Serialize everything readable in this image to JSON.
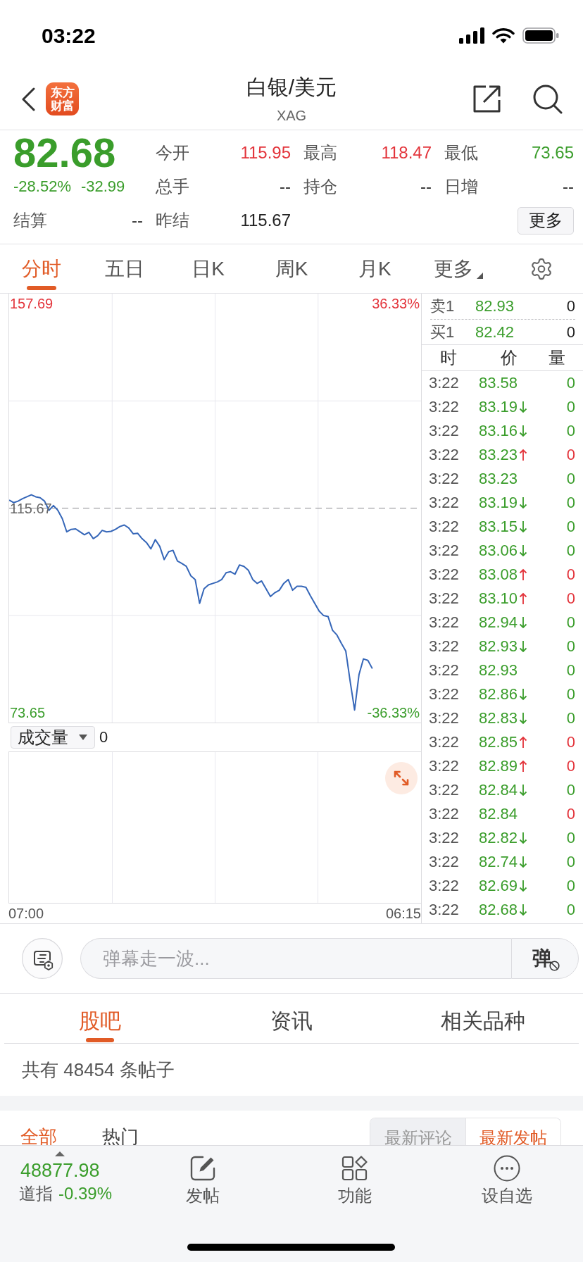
{
  "status_bar": {
    "time": "03:22"
  },
  "header": {
    "logo": "东方财富",
    "title": "白银/美元",
    "subtitle": "XAG"
  },
  "quote": {
    "price": {
      "text": "82.68",
      "color": "#3a9d2b"
    },
    "change_percent": {
      "text": "-28.52%",
      "color": "#3a9d2b"
    },
    "change": {
      "text": "-32.99",
      "color": "#3a9d2b"
    },
    "stats": [
      {
        "name": "今开",
        "value": "115.95",
        "color": "#e3343b"
      },
      {
        "name": "最高",
        "value": "118.47",
        "color": "#e3343b"
      },
      {
        "name": "最低",
        "value": "73.65",
        "color": "#3a9d2b"
      },
      {
        "name": "总手",
        "value": "--",
        "color": "#333333"
      },
      {
        "name": "持仓",
        "value": "--",
        "color": "#333333"
      },
      {
        "name": "日增",
        "value": "--",
        "color": "#333333"
      },
      {
        "name": "结算",
        "value": "--",
        "color": "#333333"
      },
      {
        "name": "昨结",
        "value": "115.67",
        "color": "#222222"
      }
    ],
    "more_button": "更多"
  },
  "chart_tabs": [
    {
      "label": "分时",
      "selected": true,
      "dropdown": false
    },
    {
      "label": "五日",
      "selected": false,
      "dropdown": false
    },
    {
      "label": "日K",
      "selected": false,
      "dropdown": false
    },
    {
      "label": "周K",
      "selected": false,
      "dropdown": false
    },
    {
      "label": "月K",
      "selected": false,
      "dropdown": false
    },
    {
      "label": "更多",
      "selected": false,
      "dropdown": true
    }
  ],
  "price_chart": {
    "percent_labels": [
      {
        "text": "36.33%",
        "color": "#e3343b"
      },
      {
        "text": "-36.33%",
        "color": "#3a9d2b"
      }
    ],
    "chart_data": {
      "type": "line",
      "categories": [
        null,
        null,
        null,
        null,
        null,
        null,
        null,
        null,
        null,
        null,
        null,
        null,
        null,
        null,
        null,
        null,
        null,
        null,
        null,
        null,
        null,
        null,
        null,
        null,
        null,
        null,
        null,
        null,
        null,
        null,
        null,
        null,
        null,
        null,
        null,
        null,
        null,
        null,
        null,
        null,
        null,
        null,
        null,
        null,
        null,
        null,
        null,
        null,
        null,
        null,
        null,
        null,
        null,
        null,
        null,
        null,
        null,
        null,
        null,
        null,
        null,
        null,
        null,
        null,
        null,
        null,
        null,
        null,
        null,
        null,
        null,
        null,
        null,
        null,
        null,
        null,
        null,
        null,
        null,
        null,
        null,
        null,
        null,
        null,
        null,
        null,
        null,
        null,
        null,
        null,
        null,
        null,
        null,
        null
      ],
      "series": [
        {
          "color": "#3566b8",
          "values": [
            117.3,
            116.8,
            117.1,
            117.6,
            118.0,
            118.4,
            118.0,
            117.8,
            117.1,
            115.2,
            116.2,
            115.2,
            113.5,
            110.8,
            111.3,
            111.4,
            110.8,
            110.2,
            110.7,
            109.4,
            110.0,
            111.1,
            110.8,
            110.9,
            111.3,
            111.9,
            112.2,
            111.6,
            110.4,
            110.5,
            109.4,
            108.6,
            107.3,
            109.2,
            107.8,
            105.1,
            106.7,
            107.0,
            104.8,
            104.3,
            103.7,
            101.8,
            101.0,
            96.1,
            99.1,
            99.9,
            100.2,
            100.5,
            101.0,
            102.4,
            102.6,
            102.1,
            104.0,
            103.7,
            102.9,
            101.0,
            100.2,
            100.7,
            99.1,
            97.5,
            98.3,
            98.8,
            100.2,
            101.0,
            98.8,
            99.6,
            99.6,
            99.4,
            97.7,
            96.1,
            94.5,
            93.6,
            93.4,
            90.6,
            89.6,
            87.9,
            86.3,
            80.0,
            74.2,
            81.5,
            84.7,
            84.4,
            82.7,
            null,
            null,
            null,
            null,
            null,
            null,
            null,
            null,
            null,
            null,
            null
          ]
        }
      ],
      "ylim": [
        71.62,
        159.72
      ],
      "yticks": [
        {
          "value": 157.69,
          "label": "157.69"
        },
        {
          "value": 115.67,
          "label": "115.67"
        },
        {
          "value": 73.65,
          "label": "73.65"
        }
      ],
      "ref_lines": [
        {
          "axis": "y",
          "value": 115.67
        }
      ]
    }
  },
  "volume": {
    "indicator": "成交量",
    "value": "0"
  },
  "time_axis": [
    "07:00",
    "06:15"
  ],
  "order_book": [
    {
      "side": "卖1",
      "price": {
        "text": "82.93",
        "color": "#3a9d2b"
      },
      "volume": "0"
    },
    {
      "side": "买1",
      "price": {
        "text": "82.42",
        "color": "#3a9d2b"
      },
      "volume": "0"
    }
  ],
  "trades": {
    "columns": [
      "时",
      "价",
      "量"
    ],
    "rows": [
      {
        "time": "3:22",
        "price": {
          "text": "83.58",
          "color": "#3a9d2b"
        },
        "kind": "flat",
        "volume": {
          "text": "0",
          "color": "#3a9d2b"
        }
      },
      {
        "time": "3:22",
        "price": {
          "text": "83.19",
          "color": "#3a9d2b"
        },
        "kind": "down",
        "volume": {
          "text": "0",
          "color": "#3a9d2b"
        }
      },
      {
        "time": "3:22",
        "price": {
          "text": "83.16",
          "color": "#3a9d2b"
        },
        "kind": "down",
        "volume": {
          "text": "0",
          "color": "#3a9d2b"
        }
      },
      {
        "time": "3:22",
        "price": {
          "text": "83.23",
          "color": "#3a9d2b"
        },
        "kind": "up",
        "volume": {
          "text": "0",
          "color": "#e3343b"
        }
      },
      {
        "time": "3:22",
        "price": {
          "text": "83.23",
          "color": "#3a9d2b"
        },
        "kind": "flat",
        "volume": {
          "text": "0",
          "color": "#3a9d2b"
        }
      },
      {
        "time": "3:22",
        "price": {
          "text": "83.19",
          "color": "#3a9d2b"
        },
        "kind": "down",
        "volume": {
          "text": "0",
          "color": "#3a9d2b"
        }
      },
      {
        "time": "3:22",
        "price": {
          "text": "83.15",
          "color": "#3a9d2b"
        },
        "kind": "down",
        "volume": {
          "text": "0",
          "color": "#3a9d2b"
        }
      },
      {
        "time": "3:22",
        "price": {
          "text": "83.06",
          "color": "#3a9d2b"
        },
        "kind": "down",
        "volume": {
          "text": "0",
          "color": "#3a9d2b"
        }
      },
      {
        "time": "3:22",
        "price": {
          "text": "83.08",
          "color": "#3a9d2b"
        },
        "kind": "up",
        "volume": {
          "text": "0",
          "color": "#e3343b"
        }
      },
      {
        "time": "3:22",
        "price": {
          "text": "83.10",
          "color": "#3a9d2b"
        },
        "kind": "up",
        "volume": {
          "text": "0",
          "color": "#e3343b"
        }
      },
      {
        "time": "3:22",
        "price": {
          "text": "82.94",
          "color": "#3a9d2b"
        },
        "kind": "down",
        "volume": {
          "text": "0",
          "color": "#3a9d2b"
        }
      },
      {
        "time": "3:22",
        "price": {
          "text": "82.93",
          "color": "#3a9d2b"
        },
        "kind": "down",
        "volume": {
          "text": "0",
          "color": "#3a9d2b"
        }
      },
      {
        "time": "3:22",
        "price": {
          "text": "82.93",
          "color": "#3a9d2b"
        },
        "kind": "flat",
        "volume": {
          "text": "0",
          "color": "#3a9d2b"
        }
      },
      {
        "time": "3:22",
        "price": {
          "text": "82.86",
          "color": "#3a9d2b"
        },
        "kind": "down",
        "volume": {
          "text": "0",
          "color": "#3a9d2b"
        }
      },
      {
        "time": "3:22",
        "price": {
          "text": "82.83",
          "color": "#3a9d2b"
        },
        "kind": "down",
        "volume": {
          "text": "0",
          "color": "#3a9d2b"
        }
      },
      {
        "time": "3:22",
        "price": {
          "text": "82.85",
          "color": "#3a9d2b"
        },
        "kind": "up",
        "volume": {
          "text": "0",
          "color": "#e3343b"
        }
      },
      {
        "time": "3:22",
        "price": {
          "text": "82.89",
          "color": "#3a9d2b"
        },
        "kind": "up",
        "volume": {
          "text": "0",
          "color": "#e3343b"
        }
      },
      {
        "time": "3:22",
        "price": {
          "text": "82.84",
          "color": "#3a9d2b"
        },
        "kind": "down",
        "volume": {
          "text": "0",
          "color": "#3a9d2b"
        }
      },
      {
        "time": "3:22",
        "price": {
          "text": "82.84",
          "color": "#3a9d2b"
        },
        "kind": "flat",
        "volume": {
          "text": "0",
          "color": "#e3343b"
        }
      },
      {
        "time": "3:22",
        "price": {
          "text": "82.82",
          "color": "#3a9d2b"
        },
        "kind": "down",
        "volume": {
          "text": "0",
          "color": "#3a9d2b"
        }
      },
      {
        "time": "3:22",
        "price": {
          "text": "82.74",
          "color": "#3a9d2b"
        },
        "kind": "down",
        "volume": {
          "text": "0",
          "color": "#3a9d2b"
        }
      },
      {
        "time": "3:22",
        "price": {
          "text": "82.69",
          "color": "#3a9d2b"
        },
        "kind": "down",
        "volume": {
          "text": "0",
          "color": "#3a9d2b"
        }
      },
      {
        "time": "3:22",
        "price": {
          "text": "82.68",
          "color": "#3a9d2b"
        },
        "kind": "down",
        "volume": {
          "text": "0",
          "color": "#3a9d2b"
        }
      }
    ]
  },
  "comment_bar": {
    "placeholder": "弹幕走一波...",
    "toggle": "弹"
  },
  "community_tabs": [
    {
      "label": "股吧",
      "selected": true
    },
    {
      "label": "资讯",
      "selected": false
    },
    {
      "label": "相关品种",
      "selected": false
    }
  ],
  "post_count": "共有 48454 条帖子",
  "post_filters": [
    {
      "label": "全部",
      "selected": true
    },
    {
      "label": "热门",
      "selected": false
    }
  ],
  "sort_options": [
    {
      "label": "最新评论",
      "selected": false
    },
    {
      "label": "最新发帖",
      "selected": true
    }
  ],
  "footer": {
    "index_value": {
      "text": "48877.98",
      "color": "#3a9d2b"
    },
    "index_name": "道指",
    "index_change": {
      "text": "-0.39%",
      "color": "#3a9d2b"
    },
    "actions": [
      {
        "label": "发帖",
        "kind": "edit"
      },
      {
        "label": "功能",
        "kind": "apps"
      },
      {
        "label": "设自选",
        "kind": "more"
      }
    ]
  }
}
